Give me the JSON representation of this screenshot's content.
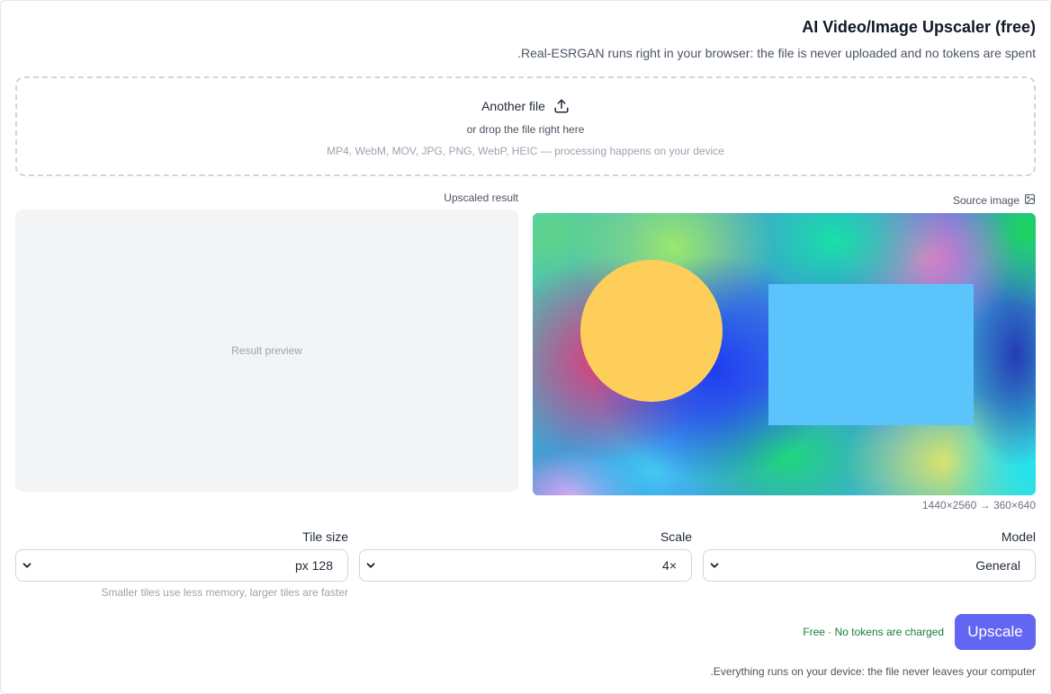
{
  "header": {
    "title": "AI Video/Image Upscaler (free)",
    "subtitle": ".Real-ESRGAN runs right in your browser: the file is never uploaded and no tokens are spent"
  },
  "dropzone": {
    "main_label": "Another file",
    "main_icon": "upload-icon",
    "sub_label": "or drop the file right here",
    "hint": "MP4, WebM, MOV, JPG, PNG, WebP, HEIC — processing happens on your device"
  },
  "result_panel": {
    "label": "Upscaled result",
    "placeholder": "Result preview"
  },
  "source_panel": {
    "label": "Source image",
    "icon": "image-icon",
    "dimensions": "1440×2560 → 360×640"
  },
  "controls": {
    "tile_size": {
      "label": "Tile size",
      "value": "px 128",
      "hint": "Smaller tiles use less memory, larger tiles are faster"
    },
    "scale": {
      "label": "Scale",
      "value": "4×"
    },
    "model": {
      "label": "Model",
      "value": "General"
    }
  },
  "actions": {
    "free_note": "Free · No tokens are charged",
    "upscale_label": "Upscale",
    "accent_color": "#6366f1"
  },
  "footer": {
    "note": ".Everything runs on your device: the file never leaves your computer"
  }
}
